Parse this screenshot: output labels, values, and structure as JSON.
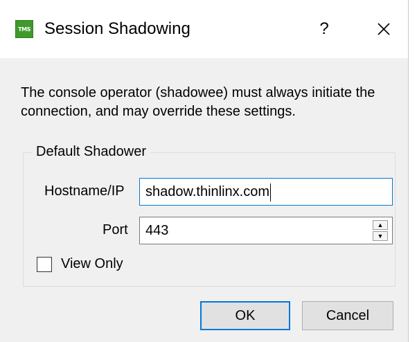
{
  "window": {
    "icon_text": "TMS",
    "title": "Session Shadowing",
    "help_label": "?",
    "close_icon": "close-icon"
  },
  "description": "The console operator (shadowee) must always initiate the connection, and may override these settings.",
  "group": {
    "title": "Default Shadower",
    "hostname_label": "Hostname/IP",
    "hostname_value": "shadow.thinlinx.com",
    "port_label": "Port",
    "port_value": "443",
    "view_only_label": "View Only",
    "view_only_checked": false
  },
  "buttons": {
    "ok": "OK",
    "cancel": "Cancel"
  },
  "colors": {
    "accent": "#0078d7",
    "icon_green": "#3f9a2c"
  }
}
